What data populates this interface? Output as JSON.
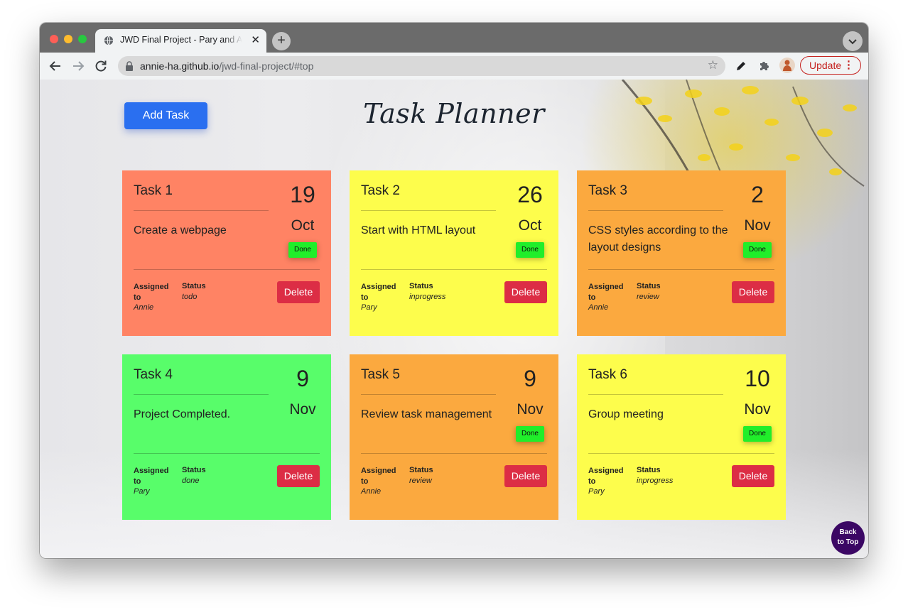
{
  "browser": {
    "tab_title": "JWD Final Project - Pary and Annie",
    "url_host": "annie-ha.github.io",
    "url_path": "/jwd-final-project/#top",
    "update_label": "Update",
    "update_color": "#c5221f"
  },
  "header": {
    "add_task_label": "Add Task",
    "title": "Task Planner"
  },
  "tasks": [
    {
      "title": "Task 1",
      "description": "Create a webpage",
      "day": "19",
      "month": "Oct",
      "done_label": "Done",
      "show_done": true,
      "assigned_label": "Assigned to",
      "assigned": "Annie",
      "status_label": "Status",
      "status": "todo",
      "delete_label": "Delete",
      "color": "#ff8364"
    },
    {
      "title": "Task 2",
      "description": "Start with HTML layout",
      "day": "26",
      "month": "Oct",
      "done_label": "Done",
      "show_done": true,
      "assigned_label": "Assigned to",
      "assigned": "Pary",
      "status_label": "Status",
      "status": "inprogress",
      "delete_label": "Delete",
      "color": "#fdfd4c"
    },
    {
      "title": "Task 3",
      "description": "CSS styles according to the layout designs",
      "day": "2",
      "month": "Nov",
      "done_label": "Done",
      "show_done": true,
      "assigned_label": "Assigned to",
      "assigned": "Annie",
      "status_label": "Status",
      "status": "review",
      "delete_label": "Delete",
      "color": "#fba93f"
    },
    {
      "title": "Task 4",
      "description": "Project Completed.",
      "day": "9",
      "month": "Nov",
      "done_label": "",
      "show_done": false,
      "assigned_label": "Assigned to",
      "assigned": "Pary",
      "status_label": "Status",
      "status": "done",
      "delete_label": "Delete",
      "color": "#58fd6a"
    },
    {
      "title": "Task 5",
      "description": "Review task management",
      "day": "9",
      "month": "Nov",
      "done_label": "Done",
      "show_done": true,
      "assigned_label": "Assigned to",
      "assigned": "Annie",
      "status_label": "Status",
      "status": "review",
      "delete_label": "Delete",
      "color": "#fba93f"
    },
    {
      "title": "Task 6",
      "description": "Group meeting",
      "day": "10",
      "month": "Nov",
      "done_label": "Done",
      "show_done": true,
      "assigned_label": "Assigned to",
      "assigned": "Pary",
      "status_label": "Status",
      "status": "inprogress",
      "delete_label": "Delete",
      "color": "#fdfd4c"
    }
  ],
  "back_to_top": {
    "line1": "Back",
    "line2": "to Top"
  },
  "colors": {
    "add_button": "#2a6ff0",
    "delete_button": "#dc2d45",
    "done_badge": "#20ee2a",
    "back_to_top": "#3b0764"
  },
  "icons": [
    "globe-icon",
    "close-icon",
    "plus-icon",
    "chevron-down-icon",
    "back-arrow-icon",
    "forward-arrow-icon",
    "reload-icon",
    "lock-icon",
    "star-icon",
    "pen-icon",
    "puzzle-icon",
    "profile-avatar-icon",
    "more-vert-icon"
  ]
}
